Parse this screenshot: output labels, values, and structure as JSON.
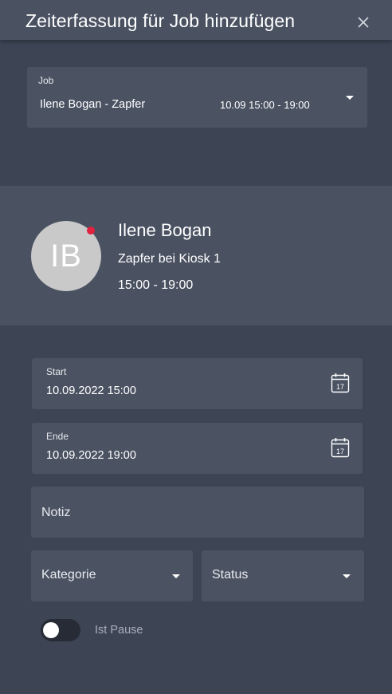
{
  "dialog": {
    "title": "Zeiterfassung für Job hinzufügen",
    "close_icon": "close-icon"
  },
  "job_select": {
    "label": "Job",
    "value": "Ilene Bogan - Zapfer",
    "time": "10.09 15:00 - 19:00"
  },
  "person_card": {
    "initials": "IB",
    "name": "Ilene Bogan",
    "role": "Zapfer bei Kiosk 1",
    "hours": "15:00 - 19:00",
    "status_color": "#e0213f"
  },
  "start_field": {
    "label": "Start",
    "value": "10.09.2022 15:00",
    "icon": "calendar-icon",
    "icon_day": "17"
  },
  "end_field": {
    "label": "Ende",
    "value": "10.09.2022 19:00",
    "icon": "calendar-icon",
    "icon_day": "17"
  },
  "note_field": {
    "placeholder": "Notiz"
  },
  "category_select": {
    "placeholder": "Kategorie"
  },
  "status_select": {
    "placeholder": "Status"
  },
  "pause_toggle": {
    "label": "Ist Pause",
    "checked": false
  },
  "colors": {
    "background": "#3d4555",
    "surface": "#4b5363",
    "accent_dot": "#e0213f"
  }
}
